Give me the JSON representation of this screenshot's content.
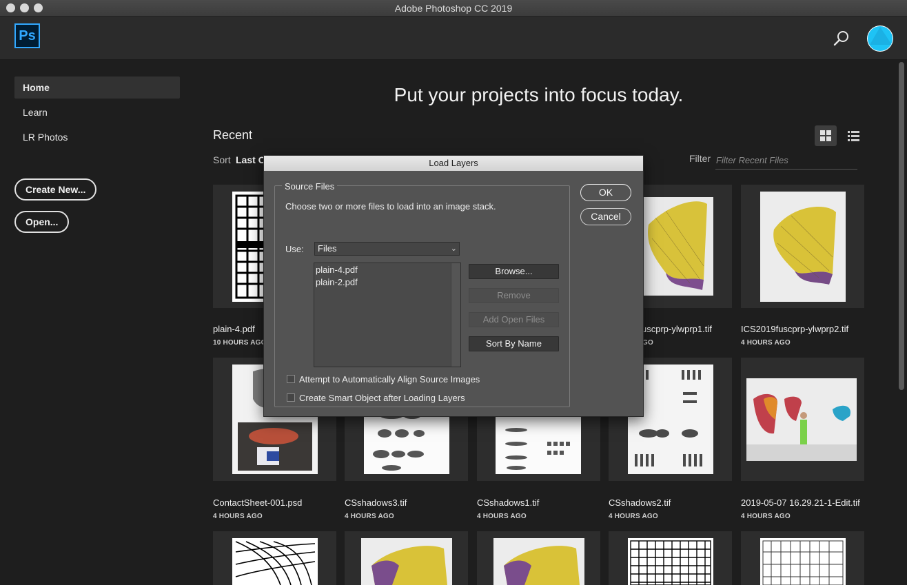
{
  "window": {
    "title": "Adobe Photoshop CC 2019"
  },
  "header": {
    "logo_text": "Ps",
    "search_icon": "search-icon",
    "avatar_color": "#1ec3f5"
  },
  "sidebar": {
    "items": [
      {
        "label": "Home",
        "active": true
      },
      {
        "label": "Learn",
        "active": false
      },
      {
        "label": "LR Photos",
        "active": false
      }
    ],
    "create_new_label": "Create New...",
    "open_label": "Open..."
  },
  "main": {
    "hero": "Put your projects into focus today.",
    "recent_title": "Recent",
    "sort_label": "Sort",
    "sort_value": "Last O",
    "filter_label": "Filter",
    "filter_placeholder": "Filter Recent Files"
  },
  "files": [
    {
      "name": "plain-4.pdf",
      "time": "10 HOURS AGO"
    },
    {
      "name": "",
      "time": ""
    },
    {
      "name": "",
      "time": ""
    },
    {
      "name": "uscprp-ylwprp1.tif",
      "time": "GO"
    },
    {
      "name": "ICS2019fuscprp-ylwprp2.tif",
      "time": "4 HOURS AGO"
    },
    {
      "name": "ContactSheet-001.psd",
      "time": "4 HOURS AGO"
    },
    {
      "name": "CSshadows3.tif",
      "time": "4 HOURS AGO"
    },
    {
      "name": "CSshadows1.tif",
      "time": "4 HOURS AGO"
    },
    {
      "name": "CSshadows2.tif",
      "time": "4 HOURS AGO"
    },
    {
      "name": "2019-05-07 16.29.21-1-Edit.tif",
      "time": "4 HOURS AGO"
    }
  ],
  "dialog": {
    "title": "Load Layers",
    "group_title": "Source Files",
    "instructions": "Choose two or more files to load into an image stack.",
    "use_label": "Use:",
    "use_value": "Files",
    "file_list": [
      "plain-4.pdf",
      "plain-2.pdf"
    ],
    "browse_label": "Browse...",
    "remove_label": "Remove",
    "add_open_label": "Add Open Files",
    "sort_label": "Sort By Name",
    "align_label": "Attempt to Automatically Align Source Images",
    "smart_object_label": "Create Smart Object after Loading Layers",
    "align_checked": false,
    "smart_object_checked": false,
    "ok_label": "OK",
    "cancel_label": "Cancel"
  }
}
